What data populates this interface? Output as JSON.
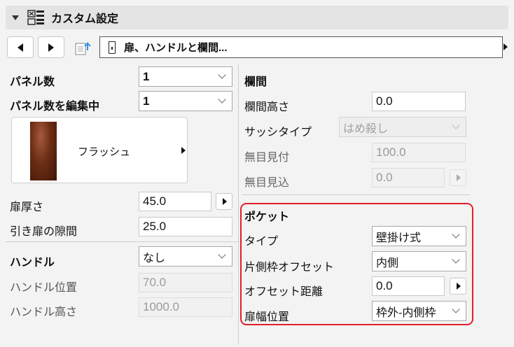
{
  "header": {
    "title": "カスタム設定"
  },
  "toolbar": {
    "breadcrumb": "扉、ハンドルと欄間..."
  },
  "left": {
    "panel_count": {
      "label": "パネル数",
      "value": "1"
    },
    "panel_editing": {
      "label": "パネル数を編集中",
      "value": "1"
    },
    "panel_preview": {
      "name": "フラッシュ"
    },
    "door_thickness": {
      "label": "扉厚さ",
      "value": "45.0"
    },
    "sliding_gap": {
      "label": "引き扉の隙間",
      "value": "25.0"
    },
    "handle": {
      "label": "ハンドル",
      "value": "なし"
    },
    "handle_position": {
      "label": "ハンドル位置",
      "value": "70.0"
    },
    "handle_height": {
      "label": "ハンドル高さ",
      "value": "1000.0"
    }
  },
  "right": {
    "transom_title": "欄間",
    "transom_height": {
      "label": "欄間高さ",
      "value": "0.0"
    },
    "sash_type": {
      "label": "サッシタイプ",
      "value": "はめ殺し"
    },
    "mullion_width": {
      "label": "無目見付",
      "value": "100.0"
    },
    "mullion_depth": {
      "label": "無目見込",
      "value": "0.0"
    },
    "pocket_title": "ポケット",
    "pocket_type": {
      "label": "タイプ",
      "value": "壁掛け式"
    },
    "side_frame_offset": {
      "label": "片側枠オフセット",
      "value": "内側"
    },
    "offset_distance": {
      "label": "オフセット距離",
      "value": "0.0"
    },
    "door_width_position": {
      "label": "扉幅位置",
      "value": "枠外-内側枠"
    }
  },
  "colors": {
    "highlight": "#e0202a",
    "header_bg": "#e4e4e4"
  }
}
